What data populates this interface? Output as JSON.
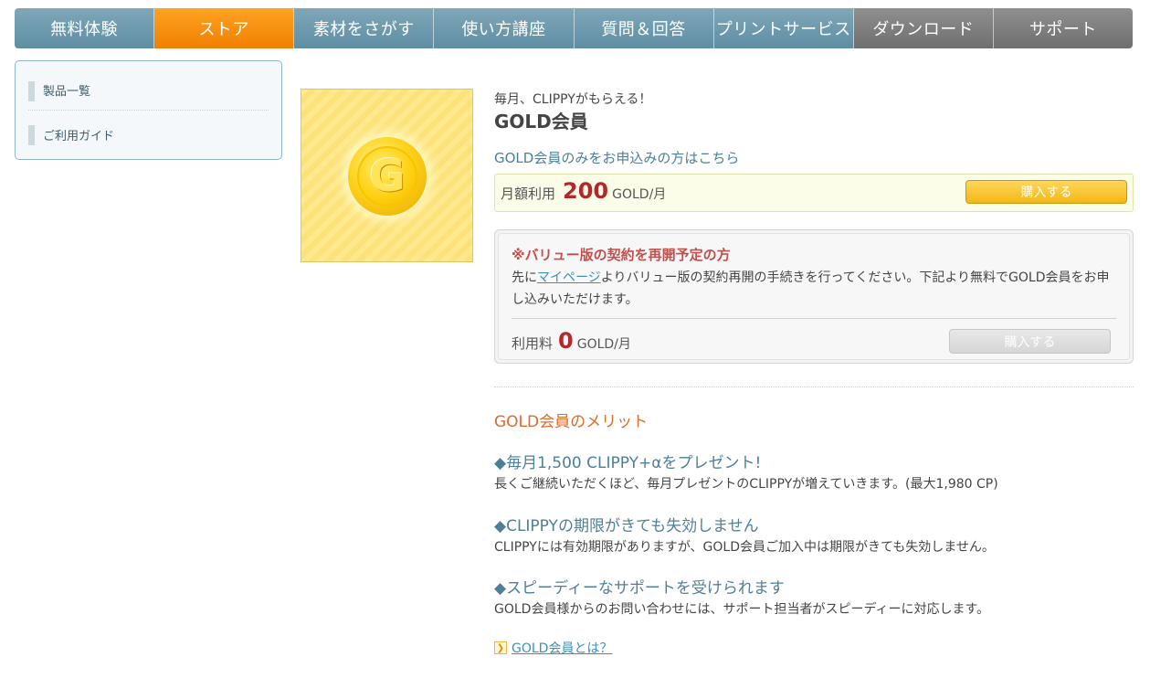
{
  "nav": {
    "items": [
      {
        "label": "無料体験"
      },
      {
        "label": "ストア"
      },
      {
        "label": "素材をさがす"
      },
      {
        "label": "使い方講座"
      },
      {
        "label": "質問＆回答"
      },
      {
        "label": "プリントサービス"
      },
      {
        "label": "ダウンロード"
      },
      {
        "label": "サポート"
      }
    ],
    "active_index": 1,
    "colors": {
      "blue": "#6b98ab",
      "active": "#f88f10",
      "gray": "#7d7d7d"
    }
  },
  "sidebar": {
    "items": [
      {
        "label": "製品一覧"
      },
      {
        "label": "ご利用ガイド"
      }
    ]
  },
  "product": {
    "image_icon": "gold-coin-icon",
    "coin_letter": "G"
  },
  "header": {
    "subtitle": "毎月、CLIPPYがもらえる！",
    "title": "GOLD会員"
  },
  "gold_only": {
    "heading": "GOLD会員のみをお申込みの方はこちら",
    "price_label": "月額利用",
    "price": "200",
    "unit": "GOLD/月",
    "button": "購入する"
  },
  "value_plan": {
    "heading": "※バリュー版の契約を再開予定の方",
    "text_before": "先に",
    "link": "マイページ",
    "text_after": "よりバリュー版の契約再開の手続きを行ってください。下記より無料でGOLD会員をお申し込みいただけます。",
    "price_label": "利用料",
    "price": "0",
    "unit": "GOLD/月",
    "button": "購入する"
  },
  "merits": {
    "heading": "GOLD会員のメリット",
    "items": [
      {
        "title": "◆毎月1,500 CLIPPY+αをプレゼント!",
        "desc": "長くご継続いただくほど、毎月プレゼントのCLIPPYが増えていきます。(最大1,980 CP)"
      },
      {
        "title": "◆CLIPPYの期限がきても失効しません",
        "desc": "CLIPPYには有効期限がありますが、GOLD会員ご加入中は期限がきても失効しません。"
      },
      {
        "title": "◆スピーディーなサポートを受けられます",
        "desc": "GOLD会員様からのお問い合わせには、サポート担当者がスピーディーに対応します。"
      }
    ]
  },
  "more": {
    "icon": "arrow-right-icon",
    "label": "GOLD会員とは？"
  }
}
